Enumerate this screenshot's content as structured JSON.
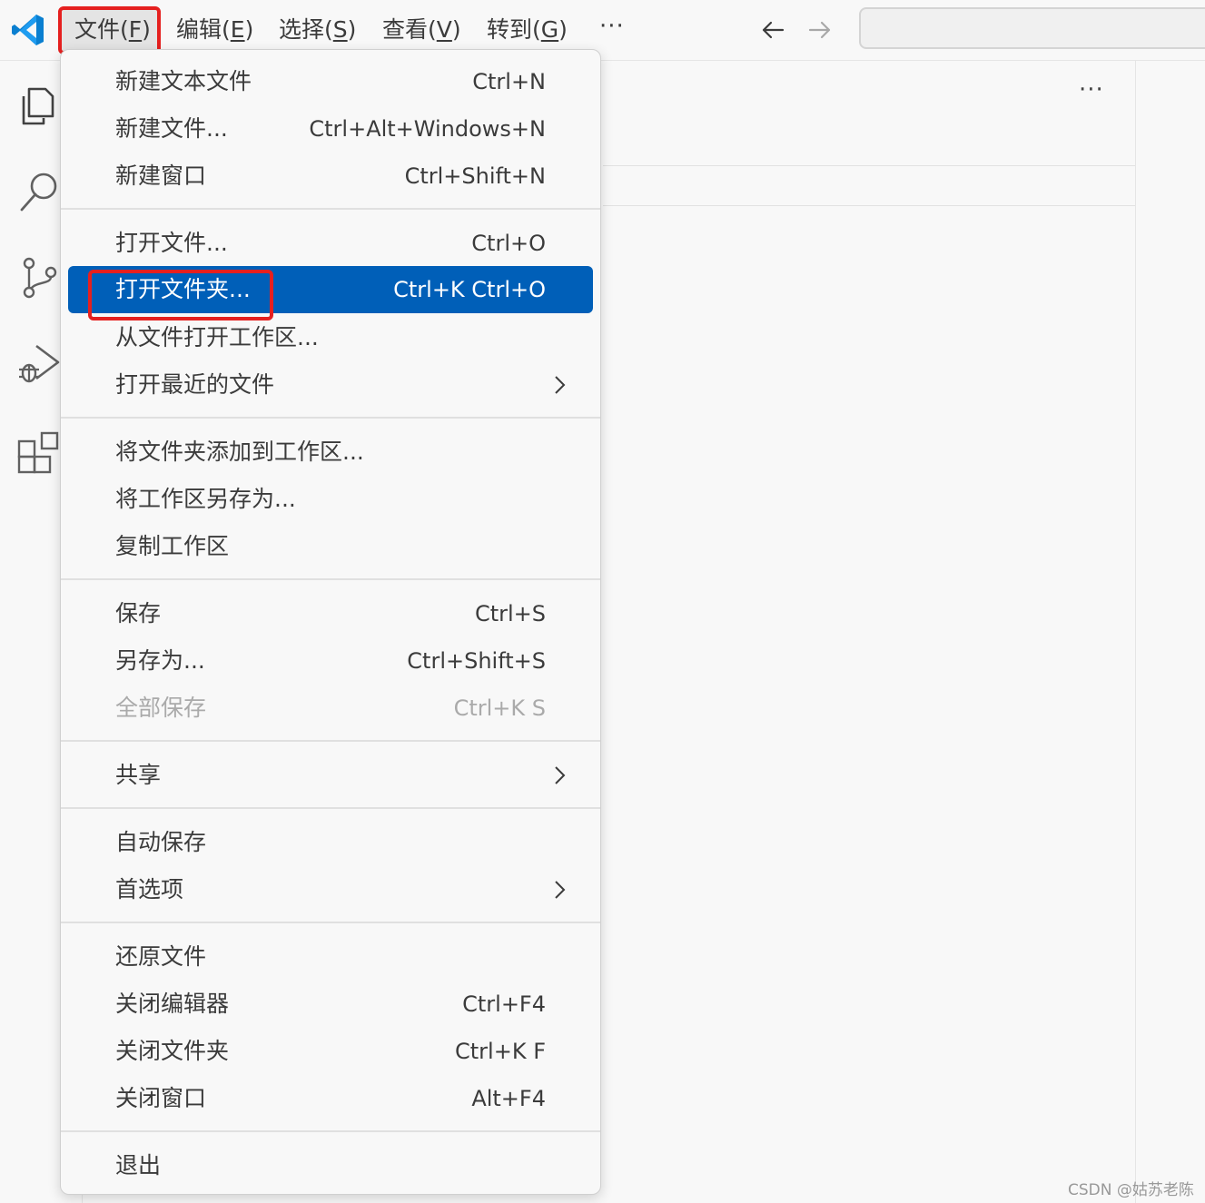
{
  "menubar": {
    "items": [
      {
        "label": "文件(",
        "mnemonic": "F",
        "suffix": ")"
      },
      {
        "label": "编辑(",
        "mnemonic": "E",
        "suffix": ")"
      },
      {
        "label": "选择(",
        "mnemonic": "S",
        "suffix": ")"
      },
      {
        "label": "查看(",
        "mnemonic": "V",
        "suffix": ")"
      },
      {
        "label": "转到(",
        "mnemonic": "G",
        "suffix": ")"
      }
    ],
    "more": "···"
  },
  "editor": {
    "more": "···"
  },
  "file_menu": {
    "items": [
      {
        "label": "新建文本文件",
        "shortcut": "Ctrl+N"
      },
      {
        "label": "新建文件...",
        "shortcut": "Ctrl+Alt+Windows+N"
      },
      {
        "label": "新建窗口",
        "shortcut": "Ctrl+Shift+N"
      },
      {
        "label": "打开文件...",
        "shortcut": "Ctrl+O"
      },
      {
        "label": "打开文件夹...",
        "shortcut": "Ctrl+K Ctrl+O",
        "selected": true
      },
      {
        "label": "从文件打开工作区...",
        "shortcut": ""
      },
      {
        "label": "打开最近的文件",
        "shortcut": "",
        "submenu": true
      },
      {
        "label": "将文件夹添加到工作区...",
        "shortcut": ""
      },
      {
        "label": "将工作区另存为...",
        "shortcut": ""
      },
      {
        "label": "复制工作区",
        "shortcut": ""
      },
      {
        "label": "保存",
        "shortcut": "Ctrl+S"
      },
      {
        "label": "另存为...",
        "shortcut": "Ctrl+Shift+S"
      },
      {
        "label": "全部保存",
        "shortcut": "Ctrl+K S",
        "disabled": true
      },
      {
        "label": "共享",
        "shortcut": "",
        "submenu": true
      },
      {
        "label": "自动保存",
        "shortcut": ""
      },
      {
        "label": "首选项",
        "shortcut": "",
        "submenu": true
      },
      {
        "label": "还原文件",
        "shortcut": ""
      },
      {
        "label": "关闭编辑器",
        "shortcut": "Ctrl+F4"
      },
      {
        "label": "关闭文件夹",
        "shortcut": "Ctrl+K F"
      },
      {
        "label": "关闭窗口",
        "shortcut": "Alt+F4"
      },
      {
        "label": "退出",
        "shortcut": ""
      }
    ]
  },
  "watermark": "CSDN @姑苏老陈",
  "colors": {
    "accent": "#005fb8",
    "annotation_red": "#e5201f",
    "vscode_blue": "#0a7fd0"
  }
}
